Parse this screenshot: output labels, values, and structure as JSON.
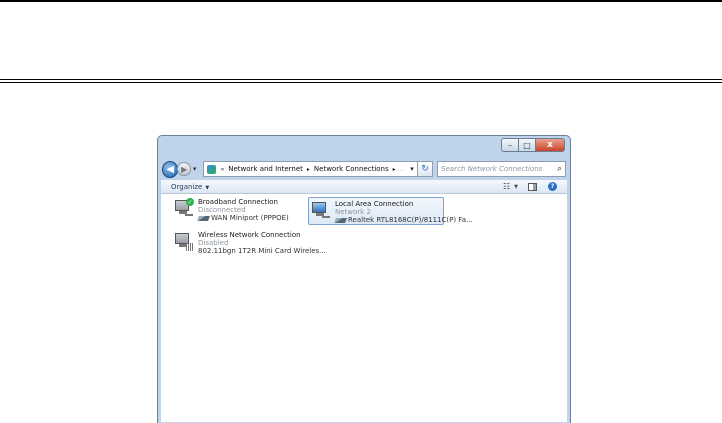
{
  "window": {
    "controls": {
      "minimize": "–",
      "maximize": "□",
      "close": "x"
    }
  },
  "nav": {
    "back_glyph": "◀",
    "forward_glyph": "▶",
    "history_glyph": "▾",
    "address": {
      "overflow": "«",
      "crumbs": [
        "Network and Internet",
        "Network Connections"
      ],
      "separator": "▸",
      "ghost": "..."
    },
    "address_drop": "▾",
    "refresh_glyph": "↻",
    "search_placeholder": "Search Network Connections",
    "search_glyph": "⌕"
  },
  "toolbar": {
    "organize_label": "Organize",
    "caret": "▼",
    "views_glyph": "☷",
    "help_glyph": "?"
  },
  "connections": [
    {
      "name": "Broadband Connection",
      "status": "Disconnected",
      "device": "WAN Miniport (PPPOE)"
    },
    {
      "name": "Local Area Connection",
      "status": "Network 2",
      "device": "Realtek RTL8168C(P)/8111C(P) Fa..."
    },
    {
      "name": "Wireless Network Connection",
      "status": "Disabled",
      "device": "802.11bgn 1T2R Mini Card Wireles..."
    }
  ]
}
